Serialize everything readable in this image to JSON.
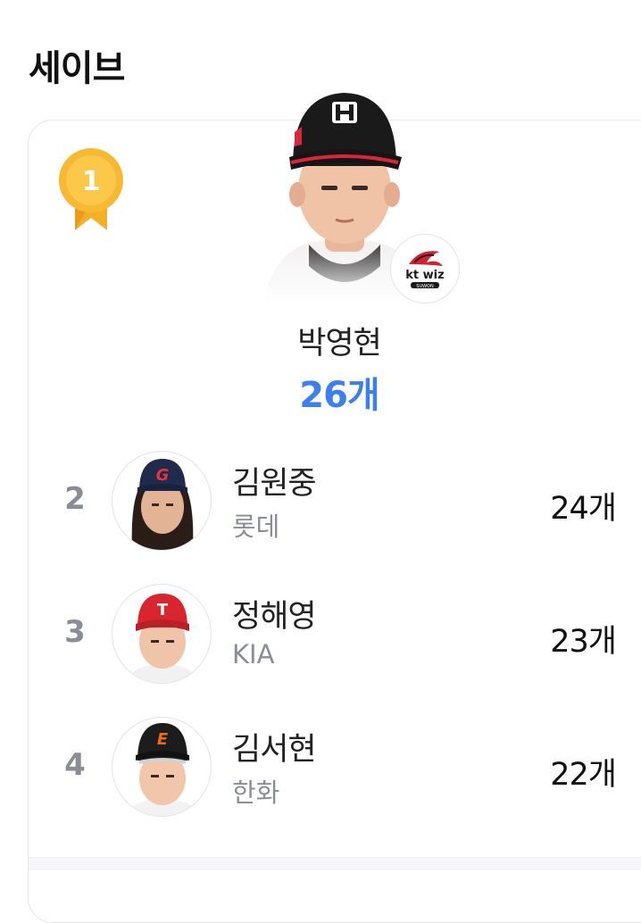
{
  "page": {
    "title": "세이브"
  },
  "leader": {
    "rank": "1",
    "name": "박영현",
    "value": "26개",
    "team_logo_text": "kt wiz",
    "team_logo_sub": "SUWON",
    "accent_color": "#3d7ef0",
    "medal_color": "#f6b93a"
  },
  "players": [
    {
      "rank": "2",
      "name": "김원중",
      "team": "롯데",
      "value": "24개",
      "cap_letter": "G",
      "cap_color": "#1f2a4d"
    },
    {
      "rank": "3",
      "name": "정해영",
      "team": "KIA",
      "value": "23개",
      "cap_letter": "T",
      "cap_color": "#d9262e"
    },
    {
      "rank": "4",
      "name": "김서현",
      "team": "한화",
      "value": "22개",
      "cap_letter": "E",
      "cap_color": "#1c1c1c"
    }
  ]
}
